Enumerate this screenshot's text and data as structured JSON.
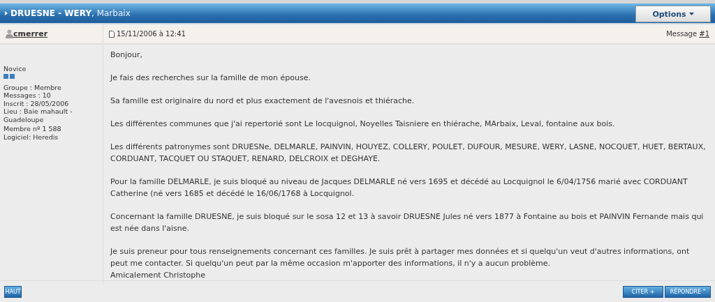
{
  "topic": {
    "title": "**DRUESNE - WERY**, Marbaix",
    "options_button": "Options"
  },
  "post": {
    "author": "cmerrer",
    "date": "15/11/2006 à 12:41",
    "message_label": "Message",
    "message_link": "#1"
  },
  "profile": {
    "rank": "Novice",
    "details": [
      "Groupe : Membre",
      "Messages : 10",
      "Inscrit : 28/05/2006",
      "Lieu : Baie mahault - Guadeloupe"
    ],
    "extra": [
      "Membre nº 1 588",
      "Logiciel: Heredis"
    ]
  },
  "body": {
    "paragraphs": [
      "Bonjour,",
      "Je fais des recherches sur la famille de mon épouse.",
      "Sa famille est originaire du nord et plus exactement de l'avesnois et thiérache.",
      "Les différentes communes que j'ai repertorié sont Le locquignol, Noyelles Taisniere en thiérache, MArbaix, Leval, fontaine aux bois.",
      "Les différents patronymes sont DRUESNe, DELMARLE, PAINVIN, HOUYEZ, COLLERY, POULET, DUFOUR, MESURE, WERY, LASNE, NOCQUET, HUET, BERTAUX, CORDUANT, TACQUET OU STAQUET, RENARD, DELCROIX et DEGHAYE.",
      "Pour la famille DELMARLE, je suis bloqué au niveau de Jacques DELMARLE né vers 1695 et décédé au Locquignol le 6/04/1756 marié avec CORDUANT Catherine (né vers 1685 et décédé le 16/06/1768 à Locquignol.",
      "Concernant la famille DRUESNE, je suis bloqué sur le sosa 12 et 13 à savoir DRUESNE Jules né vers 1877 à Fontaine au bois et PAINVIN Fernande mais qui est née dans l'aisne.",
      "Je suis preneur pour tous renseignements concernant ces familles. Je suis prêt à partager mes données et si quelqu'un veut d'autres informations, ont peut me contacter. Si quelqu'un peut par la même occasion m'apporter des informations, il n'y a aucun problème."
    ],
    "signature": "Amicalement Christophe"
  },
  "footer": {
    "top_button": "HAUT",
    "quote_button": "CITER +",
    "reply_button": "RÉPONDRE \""
  }
}
